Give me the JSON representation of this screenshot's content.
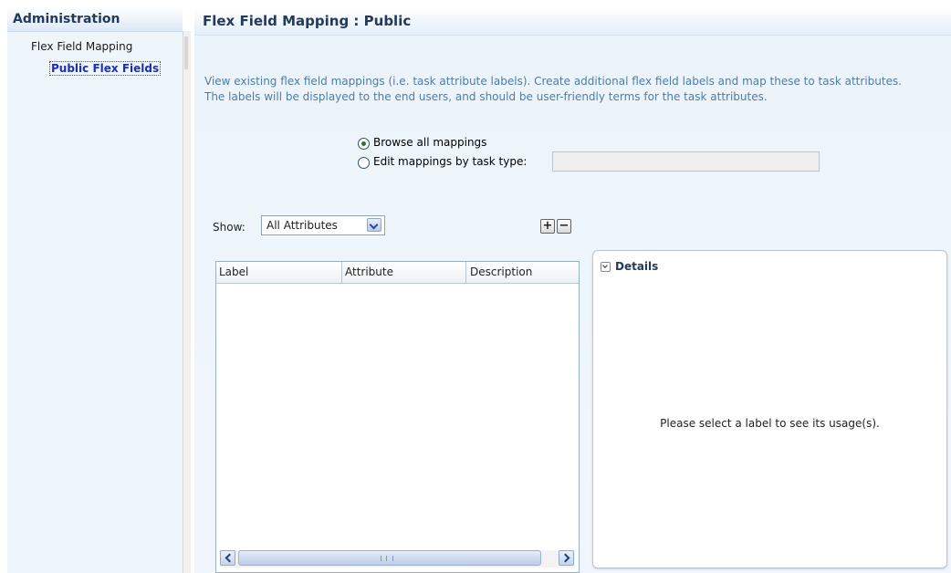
{
  "nav": {
    "title": "Administration",
    "items": [
      {
        "label": "Flex Field Mapping"
      },
      {
        "label": "Public Flex Fields"
      }
    ]
  },
  "main": {
    "title": "Flex Field Mapping : Public",
    "intro_line1": "View existing flex field mappings (i.e. task attribute labels). Create additional flex field labels and map these to task attributes.",
    "intro_line2": "The labels will be displayed to the end users, and should be user-friendly terms for the task attributes.",
    "mode": {
      "options": [
        "Browse all mappings",
        "Edit mappings by task type:"
      ],
      "selected": "Browse all mappings",
      "task_type_value": ""
    },
    "filter": {
      "label": "Show:",
      "value": "All Attributes"
    },
    "toolbar": {
      "add_label": "+",
      "remove_label": "−"
    },
    "table": {
      "columns": [
        "Label",
        "Attribute",
        "Description"
      ],
      "rows": [],
      "scroll_grip": "III"
    },
    "details": {
      "title": "Details",
      "empty_message": "Please select a label to see its usage(s)."
    }
  },
  "colors": {
    "title": "#233a5a",
    "intro_text": "#4d7ca7",
    "selected_nav": "#1c2eb8",
    "panel_bg": "#eef5fb"
  }
}
